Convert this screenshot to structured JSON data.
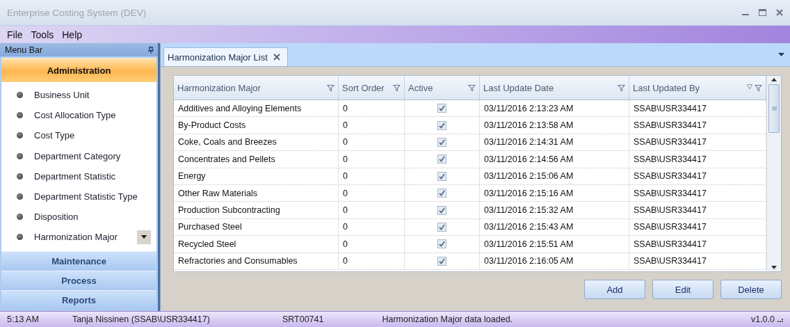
{
  "window": {
    "title": "Enterprise Costing System (DEV)"
  },
  "menu": [
    "File",
    "Tools",
    "Help"
  ],
  "sidebar": {
    "title": "Menu Bar",
    "groups": [
      {
        "label": "Administration",
        "expanded": true,
        "items": [
          {
            "label": "Business Unit",
            "selected": false
          },
          {
            "label": "Cost Allocation Type",
            "selected": false
          },
          {
            "label": "Cost Type",
            "selected": false
          },
          {
            "label": "Department Category",
            "selected": false
          },
          {
            "label": "Department Statistic",
            "selected": false
          },
          {
            "label": "Department Statistic Type",
            "selected": false
          },
          {
            "label": "Disposition",
            "selected": false
          },
          {
            "label": "Harmonization Major",
            "selected": true
          }
        ]
      },
      {
        "label": "Maintenance",
        "expanded": false
      },
      {
        "label": "Process",
        "expanded": false
      },
      {
        "label": "Reports",
        "expanded": false
      }
    ]
  },
  "tabs": [
    {
      "label": "Harmonization Major List",
      "selected": true
    }
  ],
  "table": {
    "columns": [
      "Harmonization Major",
      "Sort Order",
      "Active",
      "Last Update Date",
      "Last Updated By"
    ],
    "rows": [
      {
        "name": "Additives and Alloying Elements",
        "sort_order": "0",
        "active": true,
        "updated": "03/11/2016 2:13:23 AM",
        "by": "SSAB\\USR334417"
      },
      {
        "name": "By-Product Costs",
        "sort_order": "0",
        "active": true,
        "updated": "03/11/2016 2:13:58 AM",
        "by": "SSAB\\USR334417"
      },
      {
        "name": "Coke, Coals and Breezes",
        "sort_order": "0",
        "active": true,
        "updated": "03/11/2016 2:14:31 AM",
        "by": "SSAB\\USR334417"
      },
      {
        "name": "Concentrates and Pellets",
        "sort_order": "0",
        "active": true,
        "updated": "03/11/2016 2:14:56 AM",
        "by": "SSAB\\USR334417"
      },
      {
        "name": "Energy",
        "sort_order": "0",
        "active": true,
        "updated": "03/11/2016 2:15:06 AM",
        "by": "SSAB\\USR334417"
      },
      {
        "name": "Other Raw Materials",
        "sort_order": "0",
        "active": true,
        "updated": "03/11/2016 2:15:16 AM",
        "by": "SSAB\\USR334417"
      },
      {
        "name": "Production Subcontracting",
        "sort_order": "0",
        "active": true,
        "updated": "03/11/2016 2:15:32 AM",
        "by": "SSAB\\USR334417"
      },
      {
        "name": "Purchased Steel",
        "sort_order": "0",
        "active": true,
        "updated": "03/11/2016 2:15:43 AM",
        "by": "SSAB\\USR334417"
      },
      {
        "name": "Recycled Steel",
        "sort_order": "0",
        "active": true,
        "updated": "03/11/2016 2:15:51 AM",
        "by": "SSAB\\USR334417"
      },
      {
        "name": "Refractories and Consumables",
        "sort_order": "0",
        "active": true,
        "updated": "03/11/2016 2:16:05 AM",
        "by": "SSAB\\USR334417"
      }
    ]
  },
  "buttons": [
    "Add",
    "Edit",
    "Delete"
  ],
  "status_bar": {
    "time": "5:13 AM",
    "user": "Tanja Nissinen (SSAB\\USR334417)",
    "code": "SRT00741",
    "message": "Harmonization Major data loaded.",
    "version": "v1.0.0"
  }
}
